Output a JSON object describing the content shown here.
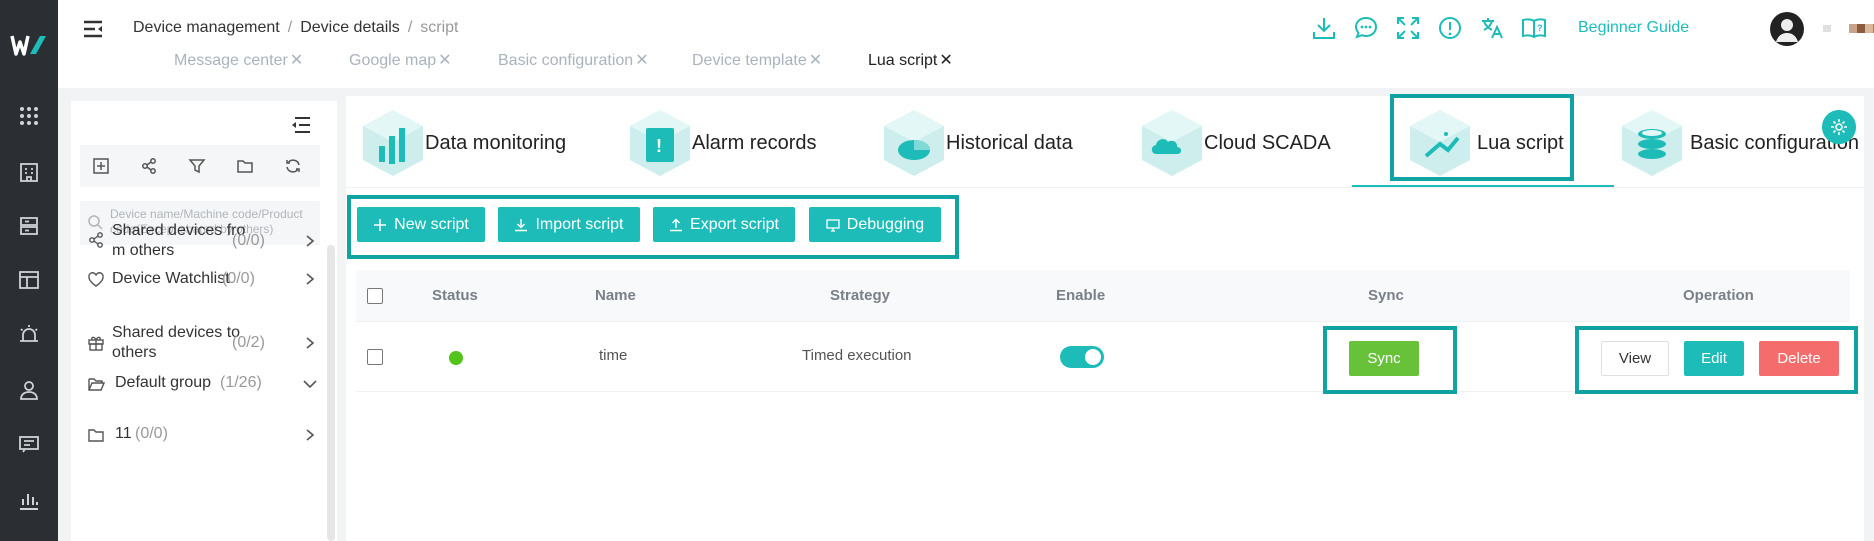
{
  "header": {
    "breadcrumb": [
      "Device management",
      "Device details",
      "script"
    ],
    "guide_label": "Beginner Guide"
  },
  "open_tabs": [
    {
      "label": "Message center",
      "active": false
    },
    {
      "label": "Google map",
      "active": false
    },
    {
      "label": "Basic configuration",
      "active": false
    },
    {
      "label": "Device template",
      "active": false
    },
    {
      "label": "Lua script",
      "active": true
    }
  ],
  "rail_icons": [
    "grid-icon",
    "building-icon",
    "server-icon",
    "dashboard-icon",
    "alarm-icon",
    "user-icon",
    "message-icon",
    "chart-icon"
  ],
  "header_icons": [
    "download-icon",
    "chat-icon",
    "fullscreen-icon",
    "info-icon",
    "translate-icon",
    "help-book-icon"
  ],
  "tree": {
    "search_placeholder": "Device name/Machine code/Product code(Except shared by others)",
    "nodes": [
      {
        "label_line1": "Shared devices fro",
        "label_line2": "m others",
        "count": "(0/0)",
        "icon": "share-icon",
        "chevron": "chevron-right-icon"
      },
      {
        "label_line1": "Device Watchlist",
        "label_line2": "",
        "count": "(0/0)",
        "icon": "heart-icon",
        "chevron": "chevron-right-icon"
      },
      {
        "label_line1": "Shared devices to",
        "label_line2": "others",
        "count": "(0/2)",
        "icon": "gift-icon",
        "chevron": "chevron-right-icon"
      },
      {
        "label_line1": "Default group",
        "label_line2": "",
        "count": "(1/26)",
        "icon": "folder-open-icon",
        "chevron": "chevron-down-icon"
      },
      {
        "label_line1": "11",
        "label_line2": "",
        "count": "(0/0)",
        "icon": "folder-icon",
        "chevron": "chevron-right-icon"
      }
    ]
  },
  "features": [
    {
      "label": "Data monitoring"
    },
    {
      "label": "Alarm records"
    },
    {
      "label": "Historical data"
    },
    {
      "label": "Cloud SCADA"
    },
    {
      "label": "Lua script"
    },
    {
      "label": "Basic configuration"
    }
  ],
  "actions": {
    "new": "New script",
    "import": "Import script",
    "export": "Export script",
    "debug": "Debugging"
  },
  "table": {
    "headers": {
      "status": "Status",
      "name": "Name",
      "strategy": "Strategy",
      "enable": "Enable",
      "sync": "Sync",
      "operation": "Operation"
    },
    "rows": [
      {
        "name": "time",
        "strategy": "Timed execution",
        "status": "online",
        "enabled": true,
        "sync_label": "Sync",
        "view_label": "View",
        "edit_label": "Edit",
        "delete_label": "Delete"
      }
    ]
  },
  "colors": {
    "accent": "#1ebcb8",
    "highlight_border": "#0fa3a3",
    "sync_green": "#67c23a",
    "delete_red": "#f56c6c",
    "status_green": "#52c41a",
    "rail_bg": "#2b2f33"
  }
}
